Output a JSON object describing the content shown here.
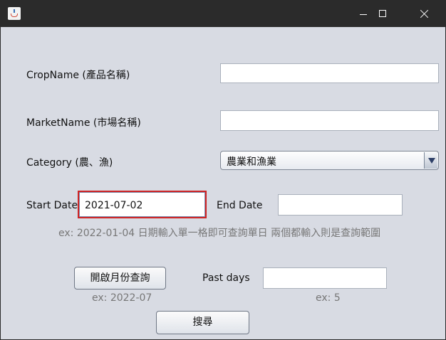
{
  "form": {
    "crop_label": "CropName (產品名稱)",
    "crop_value": "",
    "market_label": "MarketName (市場名稱)",
    "market_value": "",
    "category_label": "Category (農、漁)",
    "category_selected": "農業和漁業",
    "start_label": "Start Date",
    "start_value": "2021-07-02",
    "end_label": "End Date",
    "end_value": "",
    "date_hint": "ex:  2022-01-04 日期輸入單一格即可查詢單日 兩個都輸入則是查詢範圍",
    "month_button": "開啟月份查詢",
    "month_hint": "ex:  2022-07",
    "past_days_label": "Past days",
    "past_days_value": "",
    "past_days_hint": "ex:  5",
    "search_button": "搜尋"
  },
  "colors": {
    "background": "#d8dbe3",
    "titlebar": "#2b2b2b",
    "focus_border": "#d02222"
  },
  "icons": [
    "app-icon",
    "minimize-icon",
    "maximize-icon",
    "close-icon",
    "dropdown-arrow-icon"
  ]
}
